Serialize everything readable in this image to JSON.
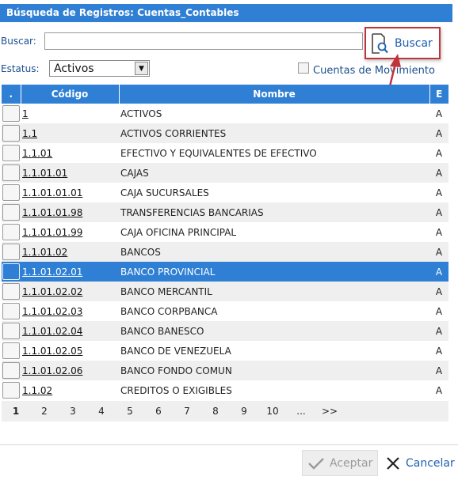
{
  "dialog": {
    "title": "Búsqueda de Registros: Cuentas_Contables"
  },
  "search": {
    "label": "Buscar:",
    "value": "",
    "placeholder": "",
    "button_label": "Buscar"
  },
  "status": {
    "label": "Estatus:",
    "selected": "Activos"
  },
  "movement_filter": {
    "label": "Cuentas de Movimiento",
    "checked": false
  },
  "table": {
    "headers": {
      "select": ".",
      "code": "Código",
      "name": "Nombre",
      "status": "E"
    },
    "rows": [
      {
        "code": "1",
        "name": "ACTIVOS",
        "status": "A",
        "selected": false
      },
      {
        "code": "1.1",
        "name": "ACTIVOS CORRIENTES",
        "status": "A",
        "selected": false
      },
      {
        "code": "1.1.01",
        "name": "EFECTIVO Y EQUIVALENTES DE EFECTIVO",
        "status": "A",
        "selected": false
      },
      {
        "code": "1.1.01.01",
        "name": "CAJAS",
        "status": "A",
        "selected": false
      },
      {
        "code": "1.1.01.01.01",
        "name": "CAJA SUCURSALES",
        "status": "A",
        "selected": false
      },
      {
        "code": "1.1.01.01.98",
        "name": "TRANSFERENCIAS BANCARIAS",
        "status": "A",
        "selected": false
      },
      {
        "code": "1.1.01.01.99",
        "name": "CAJA OFICINA PRINCIPAL",
        "status": "A",
        "selected": false
      },
      {
        "code": "1.1.01.02",
        "name": "BANCOS",
        "status": "A",
        "selected": false
      },
      {
        "code": "1.1.01.02.01",
        "name": "BANCO PROVINCIAL",
        "status": "A",
        "selected": true
      },
      {
        "code": "1.1.01.02.02",
        "name": "BANCO MERCANTIL",
        "status": "A",
        "selected": false
      },
      {
        "code": "1.1.01.02.03",
        "name": "BANCO CORPBANCA",
        "status": "A",
        "selected": false
      },
      {
        "code": "1.1.01.02.04",
        "name": "BANCO BANESCO",
        "status": "A",
        "selected": false
      },
      {
        "code": "1.1.01.02.05",
        "name": "BANCO DE VENEZUELA",
        "status": "A",
        "selected": false
      },
      {
        "code": "1.1.01.02.06",
        "name": "BANCO FONDO COMUN",
        "status": "A",
        "selected": false
      },
      {
        "code": "1.1.02",
        "name": "CREDITOS O EXIGIBLES",
        "status": "A",
        "selected": false
      }
    ]
  },
  "pagination": {
    "pages": [
      "1",
      "2",
      "3",
      "4",
      "5",
      "6",
      "7",
      "8",
      "9",
      "10",
      "...",
      ">>"
    ],
    "current": "1"
  },
  "footer": {
    "accept_label": "Aceptar",
    "cancel_label": "Cancelar"
  },
  "colors": {
    "header_blue": "#2f7fd4",
    "highlight_red": "#c0333a",
    "link_blue": "#1f5fb0"
  },
  "icons": {
    "search": "document-search-icon",
    "accept": "check-icon",
    "cancel": "close-icon",
    "dropdown": "chevron-down-icon"
  }
}
